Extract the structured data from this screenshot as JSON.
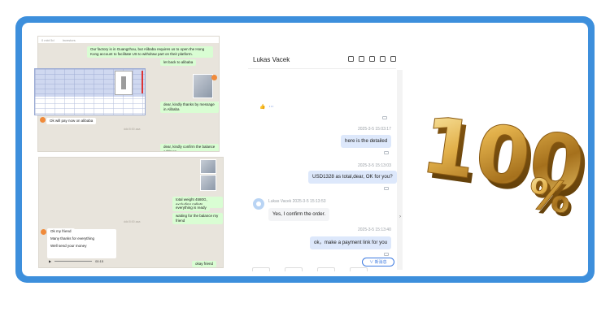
{
  "colors": {
    "frame": "#3d8fdc",
    "wa_out": "#d9fdd3",
    "chat_out": "#dde8fb",
    "chat_in": "#f3f4f6",
    "gold": "#d6a640"
  },
  "wa1": {
    "topbar": [
      "0 mbt 5d",
      "Investors"
    ],
    "out_1": "Our factory is in Guangzhou, but Alibaba requires us to open the Hong Kong account to facilitate US to withdraw part on their platform.",
    "out_2": "let back to alibaba",
    "day_1": "ddd 8:00 aaa",
    "img_caption": "Alibaba",
    "out_3": "dear, kindly thanks by message in Alibaba",
    "in_1": "Ok will pay now on alibaba",
    "day_2": "ddd 8:00 aaa",
    "out_4": "dear, kindly confirm the balance address"
  },
  "wa2": {
    "out_1": "total weight 4580G, excluding pallets",
    "out_2": "everything is ready",
    "out_3": "waiting for the balance my friend",
    "day": "ddd 8:00 aaa",
    "in_1": "Ok my friend",
    "in_2": "Many thanks for everything",
    "in_3": "Well send your money",
    "audio_time": "00:15",
    "out_4": "okay friend"
  },
  "chat": {
    "title": "Lukas Vacek",
    "ts_1": "2025-3-5 15:03:17",
    "msg_1": "here is the detailed",
    "ts_2": "2025-3-5 15:13:03",
    "msg_2": "USD1328 as total,dear, OK for you?",
    "sender_line": "Lukas Vacek 2025-3-5 15:13:53",
    "msg_3": "Yes, I confirm the order.",
    "ts_3": "2025-3-5 15:13:40",
    "msg_4": "ok，make a payment link for you",
    "new_msg_btn": "∨ 新消息"
  },
  "graphic": {
    "text": "100",
    "symbol": "%"
  }
}
